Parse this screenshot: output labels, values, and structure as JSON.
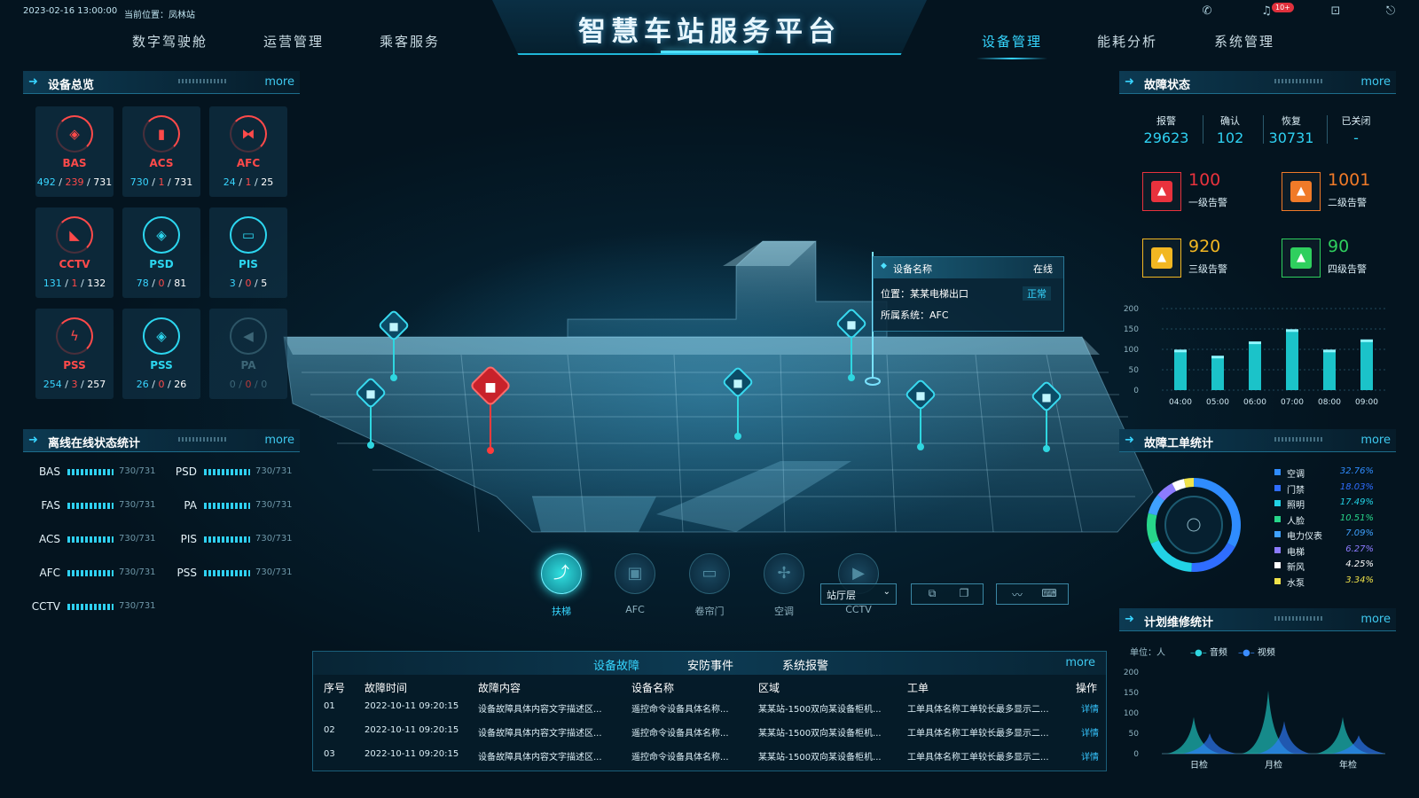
{
  "header": {
    "datetime": "2023-02-16 13:00:00",
    "location": "当前位置：凤林站",
    "title": "智慧车站服务平台",
    "nav_left": [
      "数字驾驶舱",
      "运营管理",
      "乘客服务"
    ],
    "nav_right": [
      "设备管理",
      "能耗分析",
      "系统管理"
    ],
    "active_nav": "设备管理",
    "notification_badge": "10+",
    "icons": [
      "phone-icon",
      "bell-icon",
      "lock-icon",
      "exit-icon"
    ]
  },
  "device_overview": {
    "title": "设备总览",
    "more": "more",
    "cards": [
      {
        "name": "BAS",
        "ok": "492",
        "bad": "239",
        "total": "731",
        "state": "red",
        "icon": "cube-icon"
      },
      {
        "name": "ACS",
        "ok": "730",
        "bad": "1",
        "total": "731",
        "state": "red",
        "icon": "door-icon"
      },
      {
        "name": "AFC",
        "ok": "24",
        "bad": "1",
        "total": "25",
        "state": "red",
        "icon": "gate-icon"
      },
      {
        "name": "CCTV",
        "ok": "131",
        "bad": "1",
        "total": "132",
        "state": "red",
        "icon": "camera-icon"
      },
      {
        "name": "PSD",
        "ok": "78",
        "bad": "0",
        "total": "81",
        "state": "cyan",
        "icon": "cube-icon"
      },
      {
        "name": "PIS",
        "ok": "3",
        "bad": "0",
        "total": "5",
        "state": "cyan",
        "icon": "screen-icon"
      },
      {
        "name": "PSS",
        "ok": "254",
        "bad": "3",
        "total": "257",
        "state": "red",
        "icon": "power-icon"
      },
      {
        "name": "PSS",
        "ok": "26",
        "bad": "0",
        "total": "26",
        "state": "cyan",
        "icon": "cube-icon"
      },
      {
        "name": "PA",
        "ok": "0",
        "bad": "0",
        "total": "0",
        "state": "gray",
        "icon": "speaker-icon"
      }
    ]
  },
  "online_stats": {
    "title": "离线在线状态统计",
    "more": "more",
    "left": [
      {
        "name": "BAS",
        "value": "730/731"
      },
      {
        "name": "FAS",
        "value": "730/731"
      },
      {
        "name": "ACS",
        "value": "730/731"
      },
      {
        "name": "AFC",
        "value": "730/731"
      },
      {
        "name": "CCTV",
        "value": "730/731"
      }
    ],
    "right": [
      {
        "name": "PSD",
        "value": "730/731"
      },
      {
        "name": "PA",
        "value": "730/731"
      },
      {
        "name": "PIS",
        "value": "730/731"
      },
      {
        "name": "PSS",
        "value": "730/731"
      }
    ]
  },
  "fault_status": {
    "title": "故障状态",
    "more": "more",
    "summary": [
      {
        "label": "报警",
        "value": "29623"
      },
      {
        "label": "确认",
        "value": "102"
      },
      {
        "label": "恢复",
        "value": "30731"
      },
      {
        "label": "已关闭",
        "value": "-"
      }
    ],
    "alarms": [
      {
        "value": "100",
        "label": "一级告警",
        "color": "#e8323d"
      },
      {
        "value": "1001",
        "label": "二级告警",
        "color": "#f07a28"
      },
      {
        "value": "920",
        "label": "三级告警",
        "color": "#f2b722"
      },
      {
        "value": "90",
        "label": "四级告警",
        "color": "#2fcf5e"
      }
    ]
  },
  "fault_chart": {
    "chart_data": {
      "type": "bar",
      "categories": [
        "04:00",
        "05:00",
        "06:00",
        "07:00",
        "08:00",
        "09:00"
      ],
      "values": [
        95,
        80,
        115,
        145,
        95,
        120
      ],
      "ylim": [
        0,
        200
      ],
      "yticks": [
        "200",
        "150",
        "100",
        "50",
        "0"
      ]
    }
  },
  "work_orders": {
    "title": "故障工单统计",
    "more": "more",
    "items": [
      {
        "name": "空调",
        "pct": "32.76%",
        "color": "#2f8cff"
      },
      {
        "name": "门禁",
        "pct": "18.03%",
        "color": "#2f6dff"
      },
      {
        "name": "照明",
        "pct": "17.49%",
        "color": "#22d3e6"
      },
      {
        "name": "人脸",
        "pct": "10.51%",
        "color": "#27d68a"
      },
      {
        "name": "电力仪表",
        "pct": "7.09%",
        "color": "#3fa1ff"
      },
      {
        "name": "电梯",
        "pct": "6.27%",
        "color": "#8c7bff"
      },
      {
        "name": "新风",
        "pct": "4.25%",
        "color": "#ffffff"
      },
      {
        "name": "水泵",
        "pct": "3.34%",
        "color": "#f0e34a"
      }
    ]
  },
  "maintenance": {
    "title": "计划维修统计",
    "more": "more",
    "unit": "单位：人",
    "legend": [
      "音频",
      "视频"
    ],
    "chart_data": {
      "type": "area",
      "categories": [
        "日检",
        "月检",
        "年检"
      ],
      "series": [
        {
          "name": "音频",
          "values": [
            90,
            155,
            90
          ]
        },
        {
          "name": "视频",
          "values": [
            50,
            80,
            45
          ]
        }
      ],
      "ylim": [
        0,
        200
      ],
      "yticks": [
        "200",
        "150",
        "100",
        "50",
        "0"
      ]
    }
  },
  "tooltip": {
    "name": "设备名称",
    "status": "在线",
    "location": "位置：某某电梯出口",
    "system": "所属系统：AFC",
    "health": "正常"
  },
  "toolbar": {
    "items": [
      "扶梯",
      "AFC",
      "卷帘门",
      "空调",
      "CCTV"
    ],
    "active": "扶梯",
    "floor": "站厅层"
  },
  "fault_table": {
    "tabs": [
      "设备故障",
      "安防事件",
      "系统报警"
    ],
    "active_tab": "设备故障",
    "more": "more",
    "columns": [
      "序号",
      "故障时间",
      "故障内容",
      "设备名称",
      "区域",
      "工单",
      "操作"
    ],
    "rows": [
      [
        "01",
        "2022-10-11  09:20:15",
        "设备故障具体内容文字描述区...",
        "遥控命令设备具体名称...",
        "某某站-1500双向某设备柜机...",
        "工单具体名称工单较长最多显示二...",
        "详情"
      ],
      [
        "02",
        "2022-10-11  09:20:15",
        "设备故障具体内容文字描述区...",
        "遥控命令设备具体名称...",
        "某某站-1500双向某设备柜机...",
        "工单具体名称工单较长最多显示二...",
        "详情"
      ],
      [
        "03",
        "2022-10-11  09:20:15",
        "设备故障具体内容文字描述区...",
        "遥控命令设备具体名称...",
        "某某站-1500双向某设备柜机...",
        "工单具体名称工单较长最多显示二...",
        "详情"
      ]
    ]
  }
}
